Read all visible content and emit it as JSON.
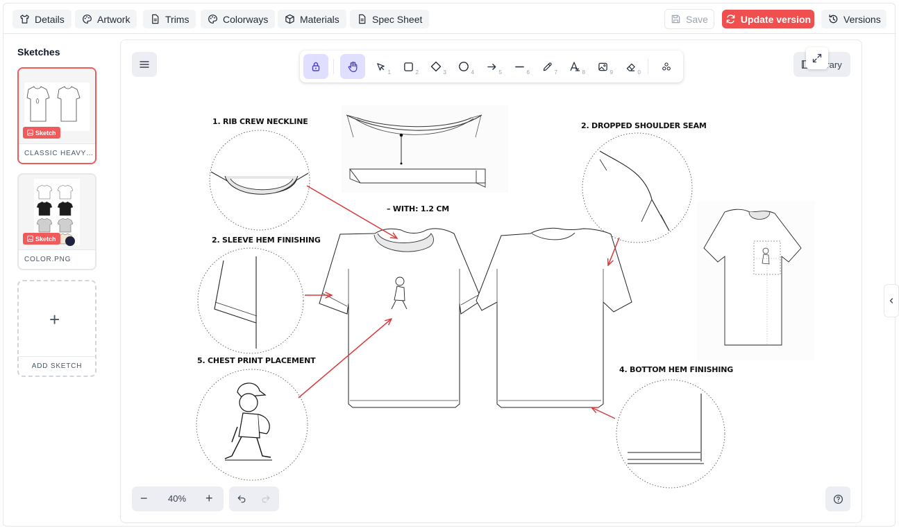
{
  "topbar": {
    "tabs": [
      {
        "label": "Details",
        "icon": "shirt-icon"
      },
      {
        "label": "Artwork",
        "icon": "palette-icon"
      },
      {
        "label": "Trims",
        "icon": "document-icon"
      },
      {
        "label": "Colorways",
        "icon": "palette-icon"
      },
      {
        "label": "Materials",
        "icon": "box-icon"
      },
      {
        "label": "Spec Sheet",
        "icon": "document-icon"
      }
    ],
    "save_label": "Save",
    "update_label": "Update version",
    "versions_label": "Versions"
  },
  "sidebar": {
    "title": "Sketches",
    "items": [
      {
        "caption": "CLASSIC HEAVYWEIGHT",
        "badge": "Sketch",
        "active": true
      },
      {
        "caption": "COLOR.PNG",
        "badge": "Sketch",
        "active": false
      }
    ],
    "add_label": "ADD SKETCH"
  },
  "canvas": {
    "library_label": "Library",
    "zoom": "40%",
    "tools": [
      {
        "name": "lock",
        "num": ""
      },
      {
        "name": "hand",
        "num": ""
      },
      {
        "name": "select",
        "num": "1"
      },
      {
        "name": "rectangle",
        "num": "2"
      },
      {
        "name": "diamond",
        "num": "3"
      },
      {
        "name": "ellipse",
        "num": "4"
      },
      {
        "name": "arrow",
        "num": "5"
      },
      {
        "name": "line",
        "num": "6"
      },
      {
        "name": "pencil",
        "num": "7"
      },
      {
        "name": "text",
        "num": "8"
      },
      {
        "name": "image",
        "num": "9"
      },
      {
        "name": "eraser",
        "num": "0"
      },
      {
        "name": "extra-tools",
        "num": ""
      }
    ],
    "annotations": {
      "neckline": "1. RIB CREW NECKLINE",
      "shoulder": "2. DROPPED SHOULDER SEAM",
      "width": "– WITH: 1.2 CM",
      "sleeve": "2. SLEEVE HEM FINISHING",
      "chest": "5. CHEST PRINT PLACEMENT",
      "bottom": "4. BOTTOM HEM FINISHING"
    }
  },
  "colors": {
    "accent": "#ef4f4f",
    "tool_active": "#e0dfff"
  }
}
